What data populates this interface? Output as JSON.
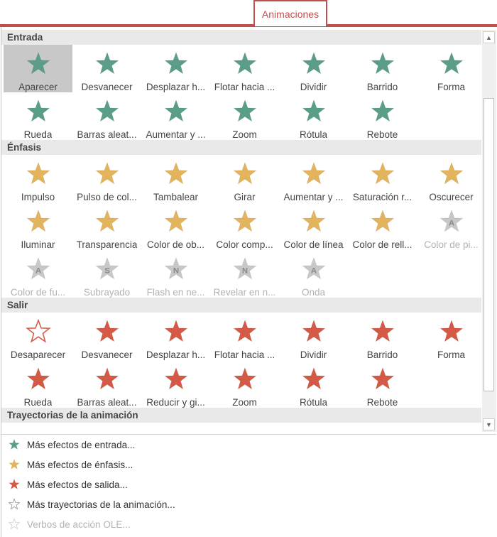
{
  "tab": {
    "label": "Animaciones"
  },
  "colors": {
    "accent": "#c0504d",
    "entrada": "#5a9e8a",
    "enfasis": "#e4b45c",
    "salir": "#d45a45",
    "disabled": "#c8c8c8"
  },
  "sections": [
    {
      "title": "Entrada",
      "color": "#5a9e8a",
      "items": [
        {
          "label": "Aparecer",
          "icon": "star-burst-icon"
        },
        {
          "label": "Desvanecer",
          "icon": "star-fade-icon"
        },
        {
          "label": "Desplazar h...",
          "icon": "star-fly-icon"
        },
        {
          "label": "Flotar hacia ...",
          "icon": "star-float-icon"
        },
        {
          "label": "Dividir",
          "icon": "star-split-icon"
        },
        {
          "label": "Barrido",
          "icon": "star-wipe-icon"
        },
        {
          "label": "Forma",
          "icon": "star-shape-icon"
        },
        {
          "label": "Rueda",
          "icon": "star-wheel-icon"
        },
        {
          "label": "Barras aleat...",
          "icon": "star-bars-icon"
        },
        {
          "label": "Aumentar y ...",
          "icon": "star-grow-icon"
        },
        {
          "label": "Zoom",
          "icon": "star-zoom-icon"
        },
        {
          "label": "Rótula",
          "icon": "star-swivel-icon"
        },
        {
          "label": "Rebote",
          "icon": "star-bounce-icon"
        }
      ]
    },
    {
      "title": "Énfasis",
      "color": "#e4b45c",
      "items": [
        {
          "label": "Impulso",
          "icon": "star-pulse-icon"
        },
        {
          "label": "Pulso de col...",
          "icon": "star-color-pulse-icon"
        },
        {
          "label": "Tambalear",
          "icon": "star-teeter-icon"
        },
        {
          "label": "Girar",
          "icon": "star-spin-icon"
        },
        {
          "label": "Aumentar y ...",
          "icon": "star-grow-shrink-icon"
        },
        {
          "label": "Saturación r...",
          "icon": "star-desaturate-icon"
        },
        {
          "label": "Oscurecer",
          "icon": "star-darken-icon"
        },
        {
          "label": "Iluminar",
          "icon": "star-lighten-icon"
        },
        {
          "label": "Transparencia",
          "icon": "star-transparency-icon"
        },
        {
          "label": "Color de ob...",
          "icon": "star-object-color-icon"
        },
        {
          "label": "Color comp...",
          "icon": "star-complementary-icon"
        },
        {
          "label": "Color de línea",
          "icon": "star-line-color-icon"
        },
        {
          "label": "Color de rell...",
          "icon": "star-fill-color-icon"
        },
        {
          "label": "Color de pi...",
          "icon": "star-brush-color-icon",
          "disabled": true,
          "letter": "A"
        },
        {
          "label": "Color de fu...",
          "icon": "star-font-color-icon",
          "disabled": true,
          "letter": "A"
        },
        {
          "label": "Subrayado",
          "icon": "star-underline-icon",
          "disabled": true,
          "letter": "S"
        },
        {
          "label": "Flash en ne...",
          "icon": "star-bold-flash-icon",
          "disabled": true,
          "letter": "N"
        },
        {
          "label": "Revelar en n...",
          "icon": "star-bold-reveal-icon",
          "disabled": true,
          "letter": "N"
        },
        {
          "label": "Onda",
          "icon": "star-wave-icon",
          "disabled": true,
          "letter": "A"
        }
      ]
    },
    {
      "title": "Salir",
      "color": "#d45a45",
      "items": [
        {
          "label": "Desaparecer",
          "icon": "star-disappear-icon"
        },
        {
          "label": "Desvanecer",
          "icon": "star-fade-icon"
        },
        {
          "label": "Desplazar h...",
          "icon": "star-fly-out-icon"
        },
        {
          "label": "Flotar hacia ...",
          "icon": "star-float-out-icon"
        },
        {
          "label": "Dividir",
          "icon": "star-split-icon"
        },
        {
          "label": "Barrido",
          "icon": "star-wipe-icon"
        },
        {
          "label": "Forma",
          "icon": "star-shape-icon"
        },
        {
          "label": "Rueda",
          "icon": "star-wheel-icon"
        },
        {
          "label": "Barras aleat...",
          "icon": "star-bars-icon"
        },
        {
          "label": "Reducir y gi...",
          "icon": "star-shrink-turn-icon"
        },
        {
          "label": "Zoom",
          "icon": "star-zoom-icon"
        },
        {
          "label": "Rótula",
          "icon": "star-swivel-icon"
        },
        {
          "label": "Rebote",
          "icon": "star-bounce-icon"
        }
      ]
    },
    {
      "title": "Trayectorias de la animación",
      "color": "#888888",
      "items": []
    }
  ],
  "menu": [
    {
      "label": "Más efectos de entrada...",
      "icon": "green-star-icon",
      "color": "#5a9e8a"
    },
    {
      "label": "Más efectos de énfasis...",
      "icon": "yellow-star-icon",
      "color": "#e4b45c"
    },
    {
      "label": "Más efectos de salida...",
      "icon": "red-star-icon",
      "color": "#d45a45"
    },
    {
      "label": "Más trayectorias de la animación...",
      "icon": "outline-star-icon",
      "color": "#888888"
    },
    {
      "label": "Verbos de acción OLE...",
      "icon": "gear-star-icon",
      "color": "#c8c8c8",
      "disabled": true
    }
  ]
}
